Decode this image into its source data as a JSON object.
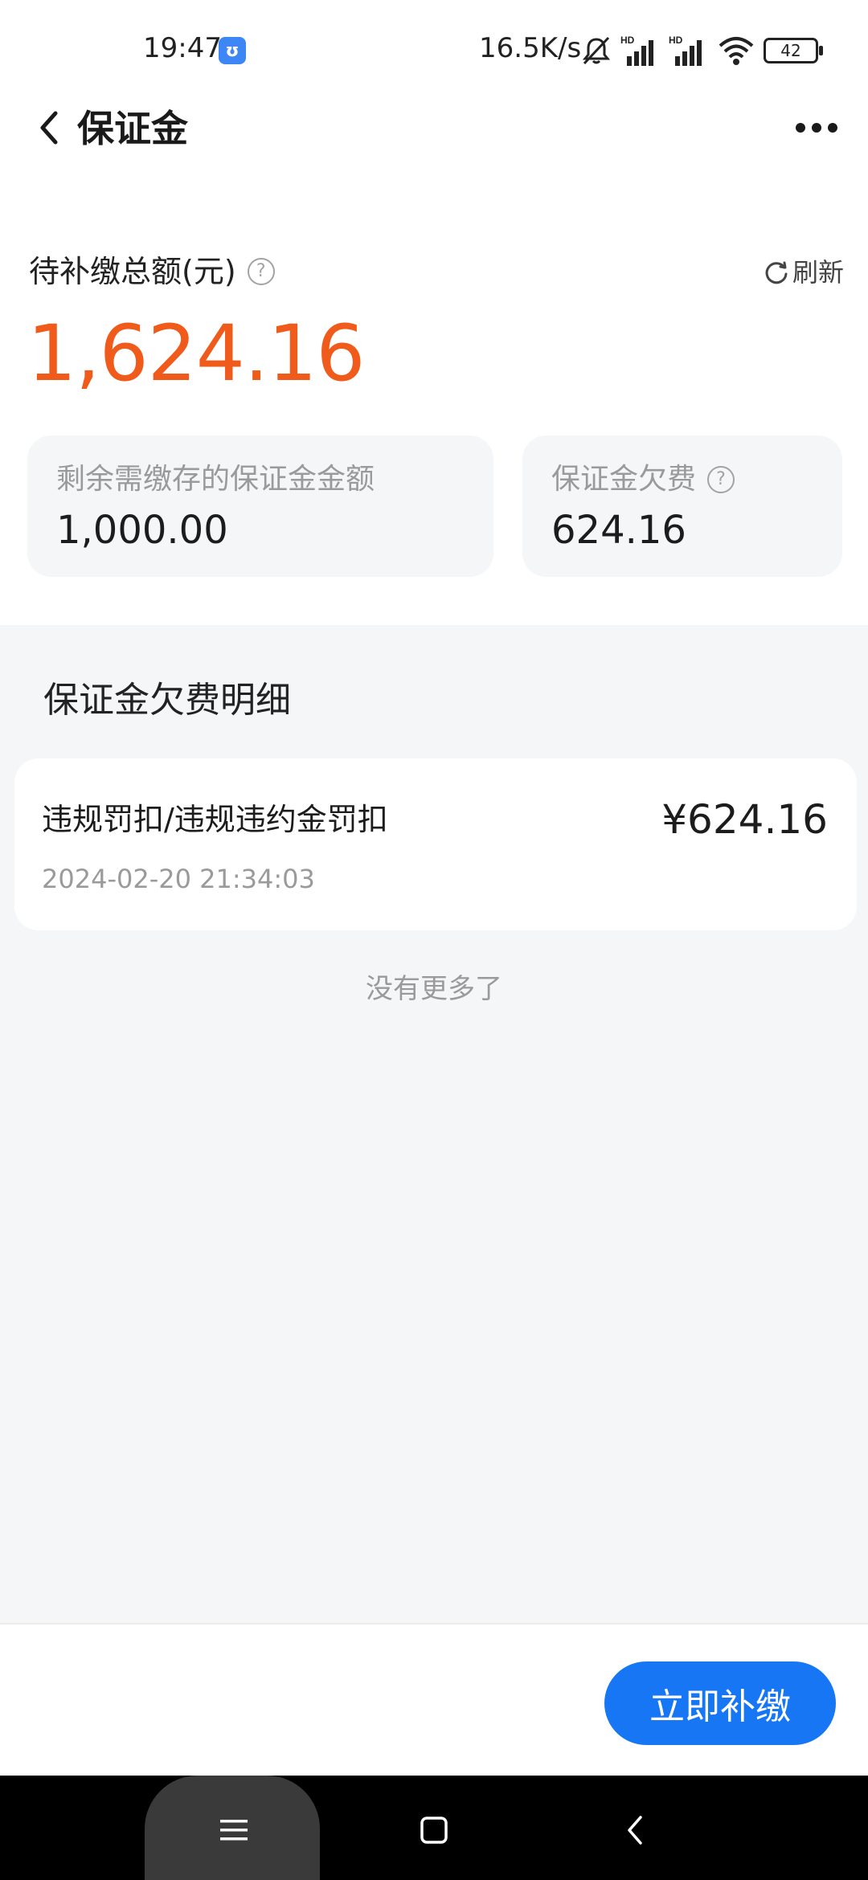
{
  "status_bar": {
    "time": "19:47",
    "network_speed": "16.5K/s",
    "battery": "42",
    "icons": [
      "mute-icon",
      "signal-icon",
      "signal-icon",
      "wifi-icon",
      "battery-icon"
    ]
  },
  "header": {
    "title": "保证金",
    "back_icon": "chevron-left-icon",
    "more_icon": "more-dots-icon"
  },
  "summary": {
    "total_label": "待补缴总额(元)",
    "refresh_label": "刷新",
    "total_amount": "1,624.16",
    "accent_color": "#f05a1a",
    "cards": [
      {
        "label": "剩余需缴存的保证金金额",
        "value": "1,000.00"
      },
      {
        "label": "保证金欠费",
        "value": "624.16"
      }
    ]
  },
  "details": {
    "title": "保证金欠费明细",
    "records": [
      {
        "title": "违规罚扣/违规违约金罚扣",
        "amount": "¥624.16",
        "time": "2024-02-20 21:34:03"
      }
    ],
    "no_more": "没有更多了"
  },
  "action": {
    "pay_label": "立即补缴",
    "button_color": "#1676f3"
  },
  "nav": {
    "icons": [
      "menu-icon",
      "home-icon",
      "back-icon"
    ]
  }
}
